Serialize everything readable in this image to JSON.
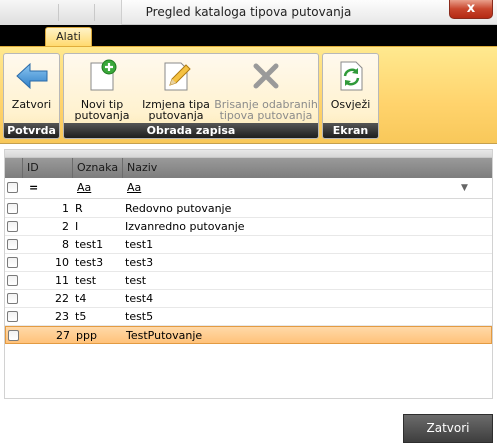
{
  "window": {
    "title": "Pregled kataloga tipova putovanja",
    "close_glyph": "x"
  },
  "ribbon": {
    "tab": "Alati",
    "groups": [
      {
        "label": "Potvrda",
        "buttons": [
          {
            "label": "Zatvori",
            "icon": "back-arrow-icon",
            "enabled": true
          }
        ]
      },
      {
        "label": "Obrada zapisa",
        "buttons": [
          {
            "label_l1": "Novi tip",
            "label_l2": "putovanja",
            "icon": "new-document-icon",
            "enabled": true
          },
          {
            "label_l1": "Izmjena tipa",
            "label_l2": "putovanja",
            "icon": "edit-pencil-icon",
            "enabled": true
          },
          {
            "label_l1": "Brisanje odabranih",
            "label_l2": "tipova putovanja",
            "icon": "delete-x-icon",
            "enabled": false
          }
        ]
      },
      {
        "label": "Ekran",
        "buttons": [
          {
            "label": "Osvježi",
            "icon": "refresh-icon",
            "enabled": true
          }
        ]
      }
    ]
  },
  "grid": {
    "columns": [
      "ID",
      "Oznaka",
      "Naziv"
    ],
    "filter": {
      "id_op": "=",
      "oznaka_op": "Aa",
      "naziv_op": "Aa"
    },
    "rows": [
      {
        "id": "1",
        "oznaka": "R",
        "naziv": "Redovno putovanje"
      },
      {
        "id": "2",
        "oznaka": "I",
        "naziv": "Izvanredno putovanje"
      },
      {
        "id": "8",
        "oznaka": "test1",
        "naziv": "test1"
      },
      {
        "id": "10",
        "oznaka": "test3",
        "naziv": "test3"
      },
      {
        "id": "11",
        "oznaka": "test",
        "naziv": "test"
      },
      {
        "id": "22",
        "oznaka": "t4",
        "naziv": "test4"
      },
      {
        "id": "23",
        "oznaka": "t5",
        "naziv": "test5"
      },
      {
        "id": "27",
        "oznaka": "ppp",
        "naziv": "TestPutovanje",
        "selected": true
      }
    ]
  },
  "footer": {
    "close_label": "Zatvori"
  },
  "colors": {
    "accent": "#ffd36c",
    "selection": "#ffc27a",
    "header": "#8a8a8a"
  }
}
